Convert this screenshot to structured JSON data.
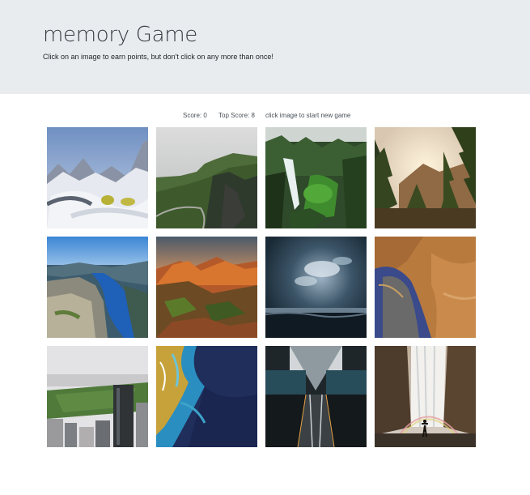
{
  "header": {
    "title": "memory Game",
    "subtitle": "Click on an image to earn points, but don't click on any more than once!"
  },
  "scoreboard": {
    "score_label": "Score:",
    "score_value": "0",
    "top_score_label": "Top Score:",
    "top_score_value": "8",
    "status": "click image to start new game"
  },
  "images": [
    {
      "name": "snowy-mountains-image"
    },
    {
      "name": "green-cliffs-road-image"
    },
    {
      "name": "forest-waterfall-image"
    },
    {
      "name": "pine-forest-sunset-image"
    },
    {
      "name": "fjord-aerial-image"
    },
    {
      "name": "red-canyon-image"
    },
    {
      "name": "stormy-sea-sky-image"
    },
    {
      "name": "desert-aerial-image"
    },
    {
      "name": "city-park-skyline-image"
    },
    {
      "name": "ocean-reef-aerial-image"
    },
    {
      "name": "escalator-station-image"
    },
    {
      "name": "waterfall-rainbow-image"
    }
  ]
}
